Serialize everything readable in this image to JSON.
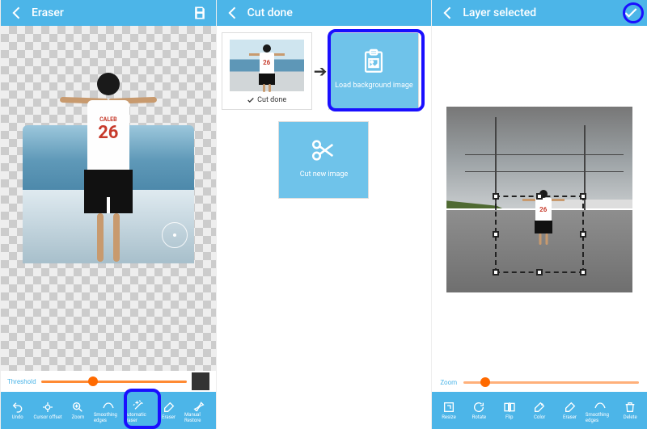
{
  "panel1": {
    "title": "Eraser",
    "jersey_small": "CALEB",
    "jersey_number": "26",
    "threshold": {
      "label": "Threshold",
      "value": 35
    },
    "tools": [
      {
        "name": "undo",
        "label": "Undo"
      },
      {
        "name": "cursor-offset",
        "label": "Cursor offset"
      },
      {
        "name": "zoom",
        "label": "Zoom"
      },
      {
        "name": "smoothing-edges",
        "label": "Smoothing edges"
      },
      {
        "name": "automatic-eraser",
        "label": "Automatic eraser"
      },
      {
        "name": "eraser",
        "label": "Eraser"
      },
      {
        "name": "manual-restore",
        "label": "Manual Restore"
      }
    ]
  },
  "panel2": {
    "title": "Cut done",
    "cut_done_label": "Cut done",
    "load_bg_label": "Load background image",
    "cut_new_label": "Cut new image",
    "jersey_number": "26"
  },
  "panel3": {
    "title": "Layer selected",
    "jersey_number": "26",
    "zoom": {
      "label": "Zoom",
      "value": 10
    },
    "tools": [
      {
        "name": "resize",
        "label": "Resize"
      },
      {
        "name": "rotate",
        "label": "Rotate"
      },
      {
        "name": "flip",
        "label": "Flip"
      },
      {
        "name": "color",
        "label": "Color"
      },
      {
        "name": "eraser",
        "label": "Eraser"
      },
      {
        "name": "smoothing-edges",
        "label": "Smoothing edges"
      },
      {
        "name": "delete",
        "label": "Delete"
      }
    ]
  }
}
